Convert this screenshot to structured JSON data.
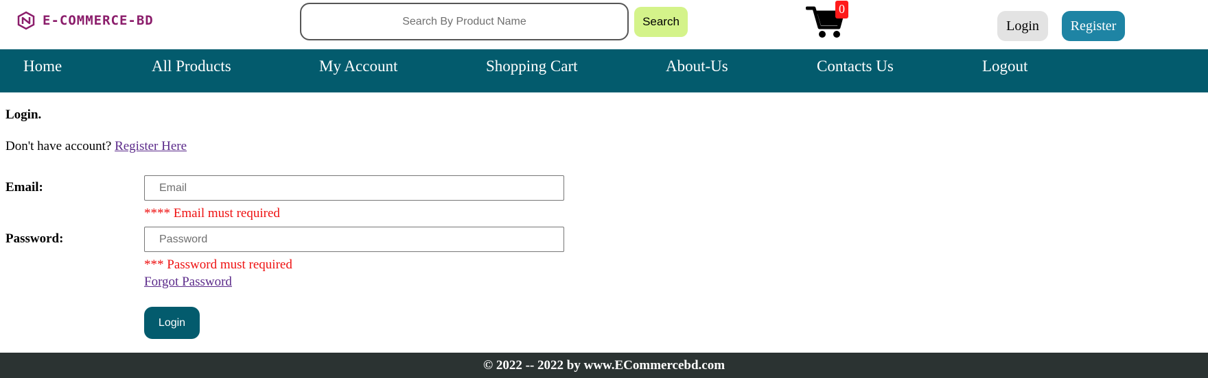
{
  "header": {
    "logo_text": "E-COMMERCE-BD",
    "search_placeholder": "Search By Product Name",
    "search_value": "",
    "search_button": "Search",
    "cart_count": "0",
    "login_button": "Login",
    "register_button": "Register"
  },
  "nav": {
    "items": [
      {
        "label": "Home"
      },
      {
        "label": "All Products"
      },
      {
        "label": "My Account"
      },
      {
        "label": "Shopping Cart"
      },
      {
        "label": "About-Us"
      },
      {
        "label": "Contacts Us"
      },
      {
        "label": "Logout"
      }
    ]
  },
  "login_form": {
    "title": "Login.",
    "no_account_text": "Don't have account? ",
    "register_link": "Register Here",
    "email_label": "Email:",
    "email_placeholder": "Email",
    "email_value": "",
    "email_error": "**** Email must required",
    "password_label": "Password:",
    "password_placeholder": "Password",
    "password_value": "",
    "password_error": "*** Password must required",
    "forgot_link": "Forgot Password",
    "submit_button": "Login"
  },
  "footer": {
    "text": "© 2022 -- 2022 by www.ECommercebd.com"
  },
  "colors": {
    "nav_bg": "#035b6d",
    "logo_color": "#8b1d6b",
    "search_button_bg": "#d4f38a",
    "register_button_bg": "#1e84a4",
    "error_color": "#ee1111",
    "badge_color": "#ff1a1a",
    "footer_bg": "#2b3332"
  }
}
